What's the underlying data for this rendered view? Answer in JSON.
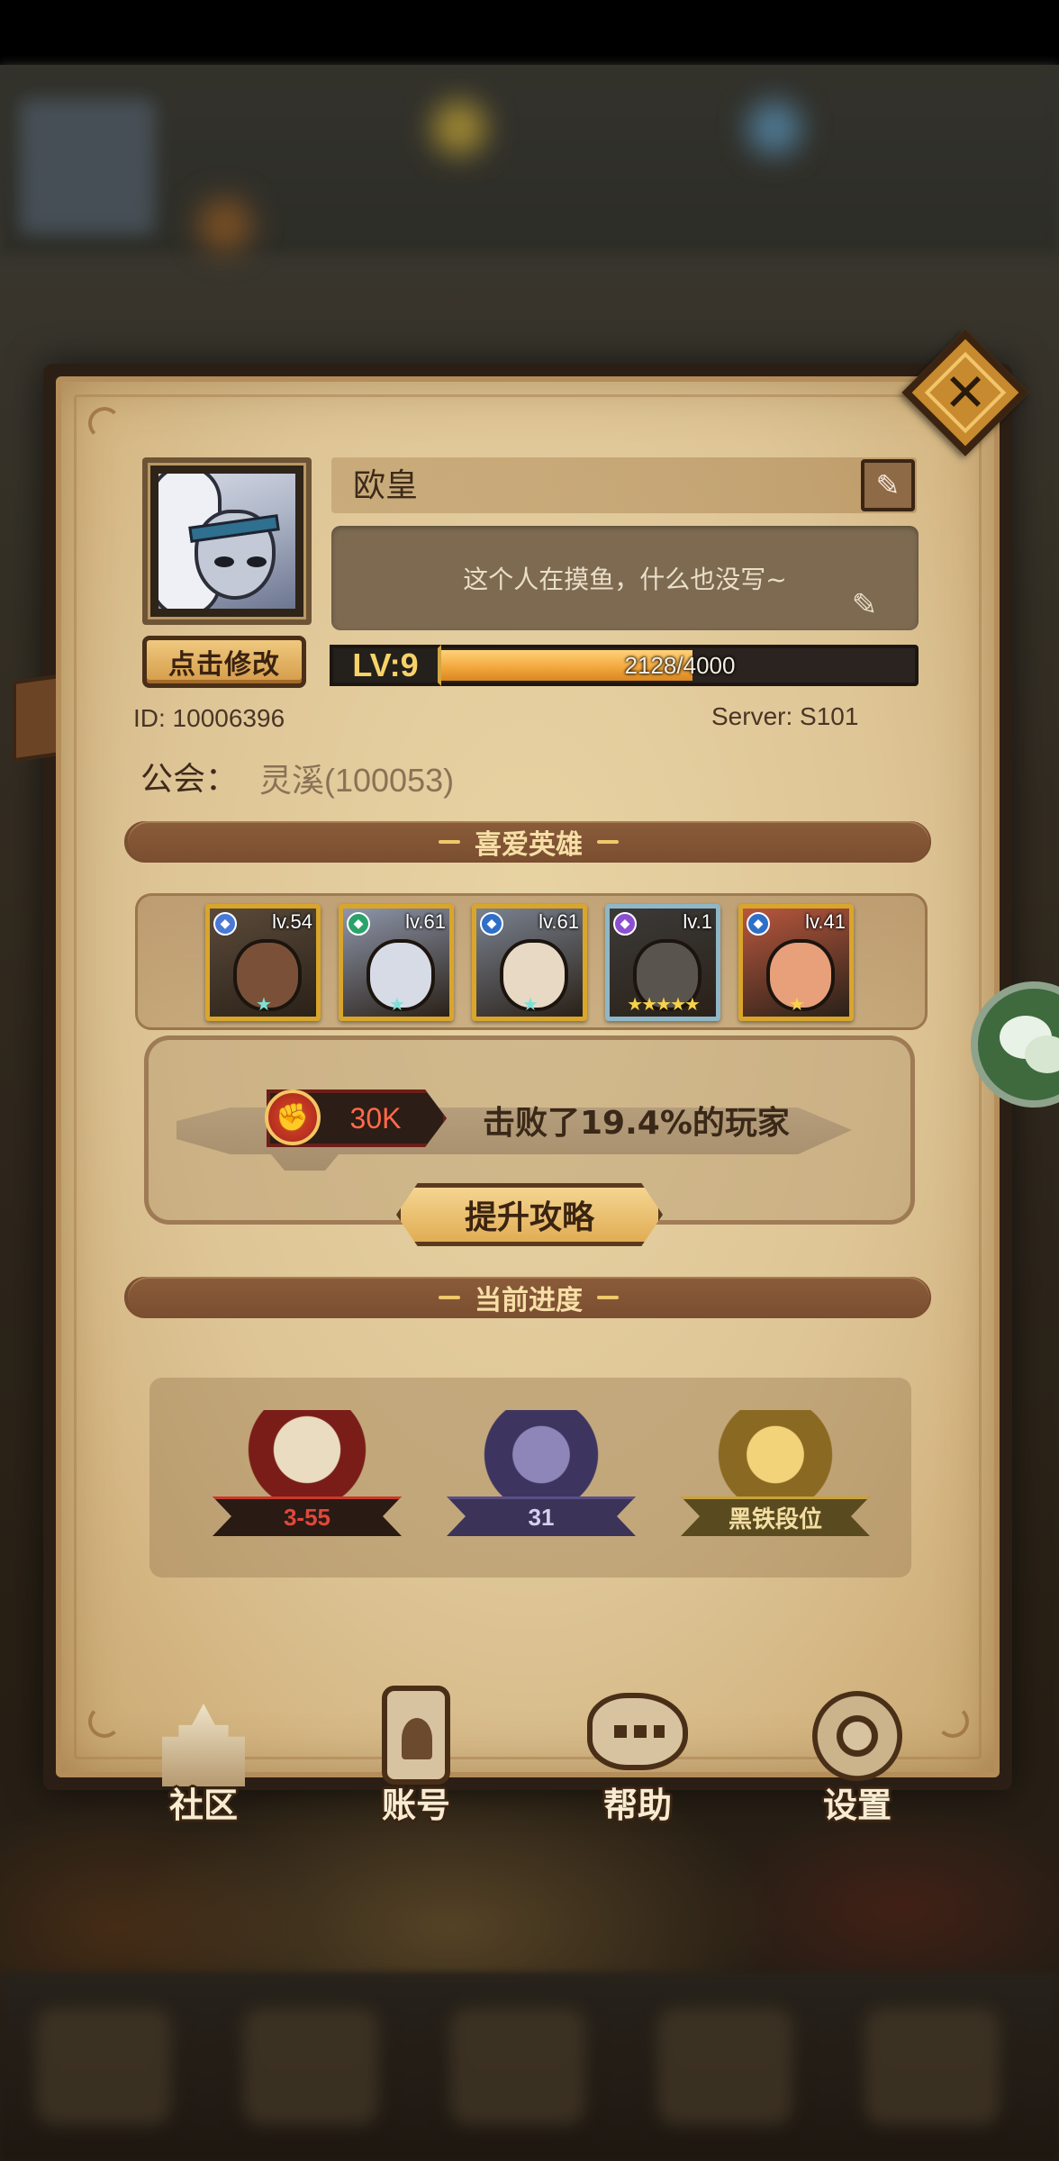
{
  "profile": {
    "edit_avatar_label": "点击修改",
    "name": "欧皇",
    "signature": "这个人在摸鱼，什么也没写~",
    "level_badge": "LV:9",
    "exp_text": "2128/4000",
    "exp_progress": 0.532,
    "id_text": "ID:  10006396",
    "server_text": "Server:  S101",
    "guild_label": "公会：",
    "guild_value": "灵溪(100053)"
  },
  "favorite_heroes": {
    "title": "喜爱英雄",
    "heroes": [
      {
        "level": "lv.54",
        "stars": "★",
        "star_color": "#7fe0d8",
        "element_color": "#4a79d6",
        "frame": "gold",
        "skin": "#7a5138",
        "bg": "#5b4a3a"
      },
      {
        "level": "lv.61",
        "stars": "★",
        "star_color": "#7fe0d8",
        "element_color": "#2aa36a",
        "frame": "gold",
        "skin": "#d7dbe6",
        "bg": "#8e96aa"
      },
      {
        "level": "lv.61",
        "stars": "★",
        "star_color": "#7fe0d8",
        "element_color": "#2e6fc7",
        "frame": "gold",
        "skin": "#e7d9c4",
        "bg": "#7a8290"
      },
      {
        "level": "lv.1",
        "stars": "★★★★★",
        "star_color": "#f7d24a",
        "element_color": "#8b4fd0",
        "frame": "silver",
        "skin": "#5a544e",
        "bg": "#3c3a38"
      },
      {
        "level": "lv.41",
        "stars": "★",
        "star_color": "#f7d24a",
        "element_color": "#2e6fc7",
        "frame": "gold",
        "skin": "#e7a07a",
        "bg": "#b8573e"
      }
    ],
    "power_value": "30K",
    "power_rank_text": "击败了19.4%的玩家",
    "guide_button": "提升攻略"
  },
  "progress": {
    "title": "当前进度",
    "items": [
      {
        "label": "3-55",
        "icon": "stage-book-icon",
        "color": "#c8392c"
      },
      {
        "label": "31",
        "icon": "tower-sword-icon",
        "color": "#5a4e86"
      },
      {
        "label": "黑铁段位",
        "icon": "arena-rank-icon",
        "color": "#c9a23a"
      }
    ]
  },
  "nav": {
    "items": [
      {
        "label": "社区",
        "icon": "castle-icon"
      },
      {
        "label": "账号",
        "icon": "phone-hood-icon"
      },
      {
        "label": "帮助",
        "icon": "chat-bubble-icon"
      },
      {
        "label": "设置",
        "icon": "gear-icon"
      }
    ]
  },
  "colors": {
    "accent_gold": "#d9a52b",
    "panel_parchment": "#dec596",
    "ribbon_brown": "#7a4e30",
    "exp_bar": "#f1a53a"
  }
}
